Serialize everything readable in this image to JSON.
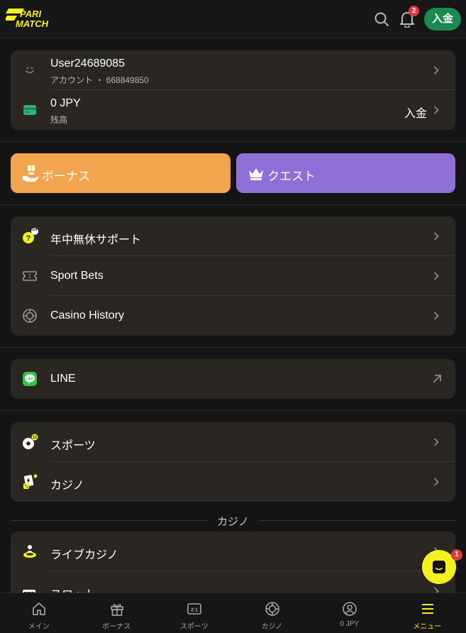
{
  "header": {
    "brand": "PARIMATCH",
    "notifications_count": "2",
    "deposit_label": "入金"
  },
  "account": {
    "username": "User24689085",
    "account_line": "アカウント ・ 668849850",
    "balance": "0 JPY",
    "balance_label": "残高",
    "deposit_link": "入金"
  },
  "promos": {
    "bonus_label": "ボーナス",
    "quest_label": "クエスト"
  },
  "menu": {
    "support_label": "年中無休サポート",
    "support_badge": "24",
    "sport_bets_label": "Sport Bets",
    "casino_history_label": "Casino History",
    "line_label": "LINE",
    "sports_label": "スポーツ",
    "casino_label": "カジノ"
  },
  "casino_section": {
    "title": "カジノ",
    "live_casino_label": "ライブカジノ",
    "slots_label": "スロット"
  },
  "chat": {
    "badge": "1"
  },
  "bottom_nav": {
    "main": "メイン",
    "bonus": "ボーナス",
    "sports": "スポーツ",
    "casino": "カジノ",
    "balance": "0 JPY",
    "menu": "メニュー"
  },
  "colors": {
    "accent_yellow": "#f6f01e",
    "deposit_green": "#1b8a4f",
    "bonus_orange": "#f2a44e",
    "quest_purple": "#8f6ed6",
    "badge_red": "#e0393e",
    "card_bg": "#2a2722"
  }
}
